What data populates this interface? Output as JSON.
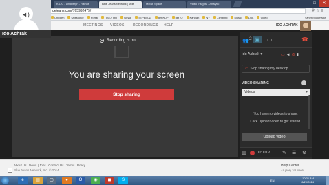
{
  "browser": {
    "tabs": [
      "KSJC - Lindbergh - Ramos",
      "Blue Jeans Network | Vide",
      "Media Space",
      "Video Insights - Analytic"
    ],
    "address": "uejeans.com/765992479/",
    "bookmarks": [
      "Chicken",
      "salesforce",
      "Portal",
      "ПВЕЛ НО",
      "Gmail",
      "ПЕРЕВОД",
      "get KDP",
      "get IO",
      "Kanban",
      "NY",
      "Climbing",
      "Music",
      "LOL",
      "Video"
    ],
    "other_bookmarks": "Other bookmarks"
  },
  "webcam": {
    "name": "Ido Achrak"
  },
  "header": {
    "nav": [
      "MEETINGS",
      "VIDEOS",
      "RECORDINGS",
      "HELP"
    ],
    "user": "IDO ACHRAK"
  },
  "main": {
    "recording": "Recording is on",
    "sharing_message": "You are sharing your screen",
    "stop_label": "Stop sharing"
  },
  "panel": {
    "participant_count": "2",
    "participant_name": "Ido Achrak",
    "stop_desktop": "Stop sharing my desktop",
    "video_sharing": "VIDEO SHARING",
    "video_select": "Videos",
    "no_videos": "You have no videos to share.",
    "click_upload": "Click Upload Video to get started.",
    "upload_label": "Upload video"
  },
  "controls": {
    "timer": "00:00:02"
  },
  "footer": {
    "links": "About Us | News | Jobs | Contact Us | Terms | Policy",
    "copyright": "Blue Jeans Network, Inc. © 2014",
    "help": "Help Center",
    "phone": "+1 (408) 791 0505"
  },
  "taskbar": {
    "lang": "EN",
    "time": "10:21 AM",
    "date": "6/20/2014"
  }
}
